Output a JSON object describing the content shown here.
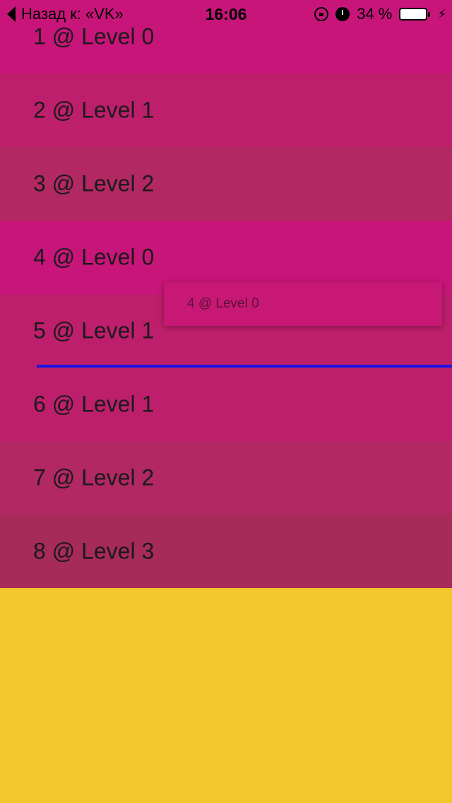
{
  "status_bar": {
    "back_label": "Назад к: «VK»",
    "time": "16:06",
    "battery_percent": "34 %",
    "battery_level": 0.34,
    "icons": [
      "orientation-lock-icon",
      "alarm-icon",
      "battery-icon",
      "charging-bolt-icon"
    ],
    "bolt_glyph": "⚡"
  },
  "rows": [
    {
      "label": "1 @ Level 0",
      "color": "#c8157a"
    },
    {
      "label": "2 @ Level 1",
      "color": "#be1f6c"
    },
    {
      "label": "3 @ Level 2",
      "color": "#b12862"
    },
    {
      "label": "4 @ Level 0",
      "color": "#c8157a"
    },
    {
      "label": "5 @ Level 1",
      "color": "#be1f6c"
    },
    {
      "label": "6 @ Level 1",
      "color": "#be1f6c"
    },
    {
      "label": "7 @ Level 2",
      "color": "#b12862"
    },
    {
      "label": "8 @ Level 3",
      "color": "#a62b59"
    }
  ],
  "drag_ghost": {
    "label": "4 @ Level 0",
    "color": "#c61874"
  },
  "drop_indicator_color": "#1a14e6",
  "background_color": "#f3c82e"
}
